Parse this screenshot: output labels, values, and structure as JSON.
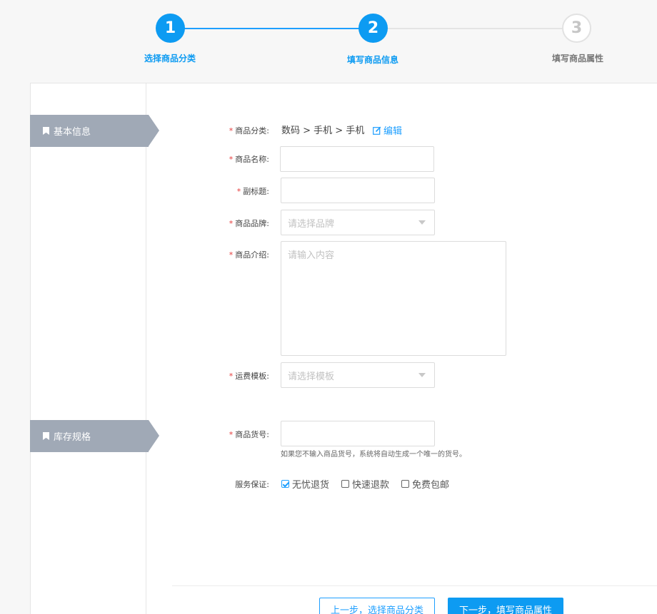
{
  "steps": [
    {
      "number": "1",
      "label": "选择商品分类",
      "state": "active"
    },
    {
      "number": "2",
      "label": "填写商品信息",
      "state": "active"
    },
    {
      "number": "3",
      "label": "填写商品属性",
      "state": "inactive"
    }
  ],
  "sections": {
    "basic": "基本信息",
    "stock": "库存规格"
  },
  "form": {
    "category": {
      "label": "商品分类:",
      "value": "数码 > 手机 > 手机",
      "edit_label": "编辑"
    },
    "name": {
      "label": "商品名称:",
      "value": ""
    },
    "subtitle": {
      "label": "副标题:",
      "value": ""
    },
    "brand": {
      "label": "商品品牌:",
      "placeholder": "请选择品牌"
    },
    "intro": {
      "label": "商品介绍:",
      "placeholder": "请输入内容"
    },
    "shipping": {
      "label": "运费模板:",
      "placeholder": "请选择模板"
    },
    "sku": {
      "label": "商品货号:",
      "value": "",
      "hint": "如果您不输入商品货号，系统将自动生成一个唯一的货号。"
    },
    "service": {
      "label": "服务保证:",
      "options": [
        {
          "label": "无忧退货",
          "checked": true
        },
        {
          "label": "快速退款",
          "checked": false
        },
        {
          "label": "免费包邮",
          "checked": false
        }
      ]
    }
  },
  "buttons": {
    "prev": "上一步，选择商品分类",
    "next": "下一步，填写商品属性"
  },
  "colors": {
    "accent": "#0d9bf2",
    "required": "#e63a3a",
    "tag": "#a0a9b6"
  }
}
